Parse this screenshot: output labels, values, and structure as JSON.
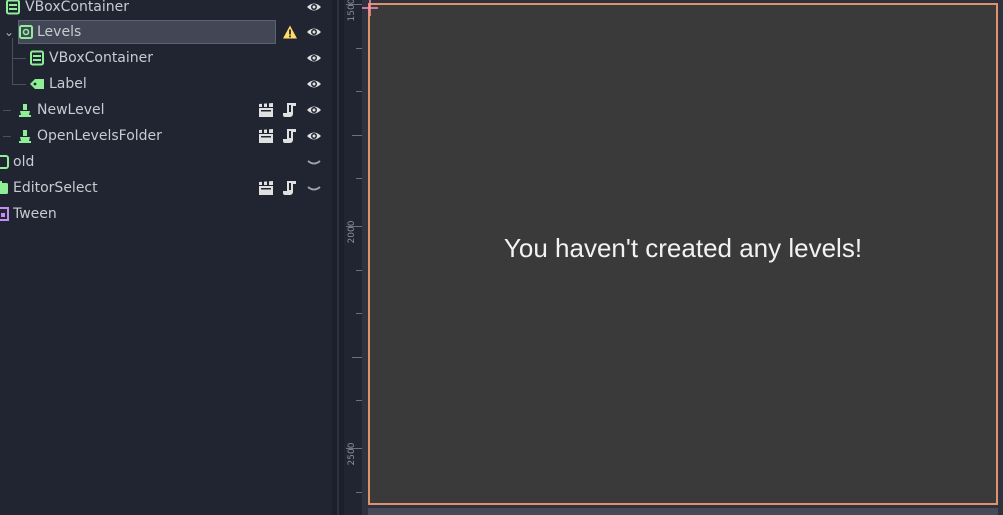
{
  "scene_tree": {
    "nodes": [
      {
        "label": "VBoxContainer",
        "icon": "vbox-container-icon",
        "selected": false
      },
      {
        "label": "Levels",
        "icon": "scroll-container-icon",
        "selected": true,
        "warning": true
      },
      {
        "label": "VBoxContainer",
        "icon": "vbox-container-icon",
        "selected": false
      },
      {
        "label": "Label",
        "icon": "label-tag-icon",
        "selected": false
      },
      {
        "label": "NewLevel",
        "icon": "button-node-icon",
        "selected": false
      },
      {
        "label": "OpenLevelsFolder",
        "icon": "button-node-icon",
        "selected": false
      },
      {
        "label": "old",
        "icon": "panel-node-icon",
        "selected": false
      },
      {
        "label": "EditorSelect",
        "icon": "folder-node-icon",
        "selected": false
      },
      {
        "label": "Tween",
        "icon": "tween-node-icon",
        "selected": false
      }
    ]
  },
  "ruler": {
    "labels": [
      "1500",
      "2000",
      "2500"
    ]
  },
  "viewport": {
    "message": "You haven't created any levels!"
  },
  "colors": {
    "panel_bg": "#202531",
    "canvas_bg": "#3a3a3a",
    "canvas_border": "#e0926a",
    "node_green": "#8eef97",
    "tween_purple": "#c38ef1",
    "warning_yellow": "#ffdd65"
  }
}
